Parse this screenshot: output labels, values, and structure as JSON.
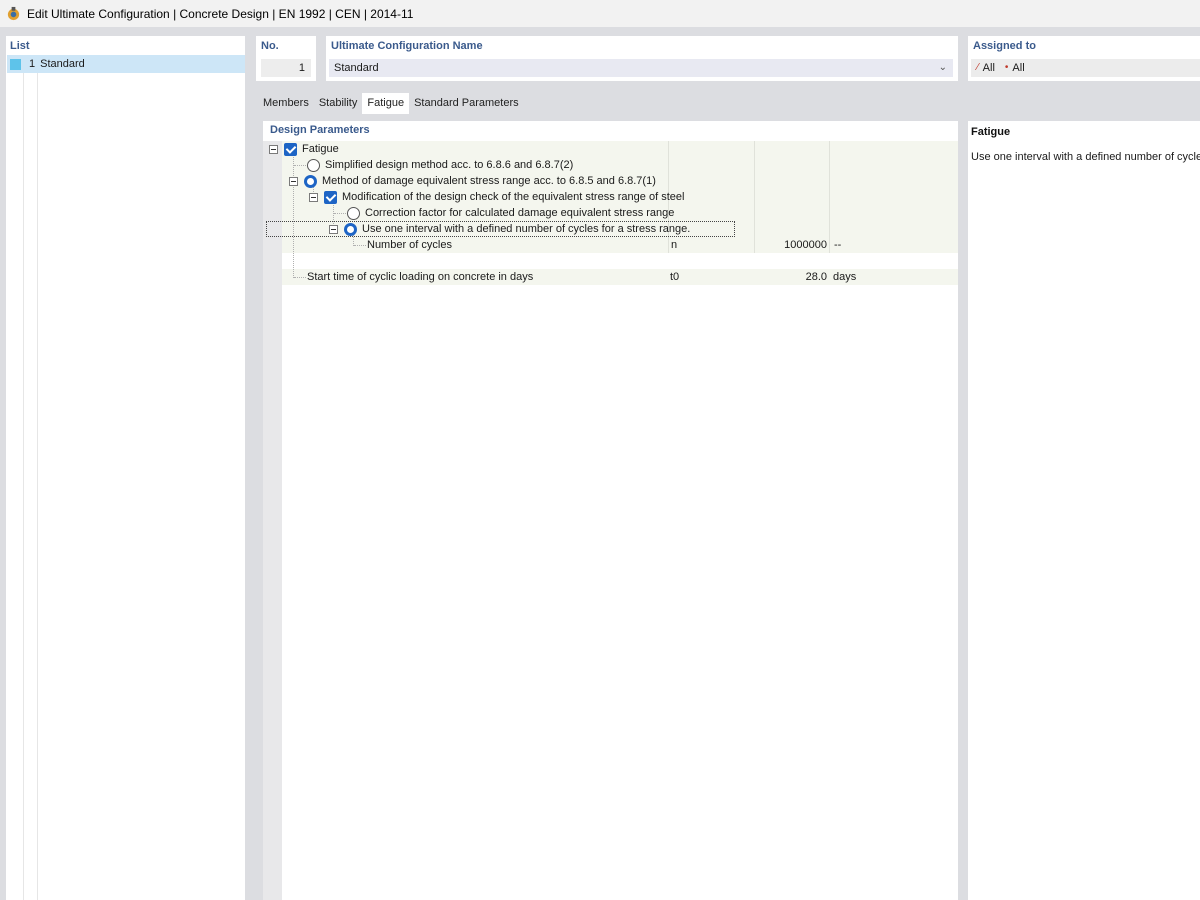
{
  "window": {
    "title": "Edit Ultimate Configuration | Concrete Design | EN 1992 | CEN | 2014-11",
    "icon": "app-logo-icon"
  },
  "list": {
    "header": "List",
    "items": [
      {
        "number": "1",
        "name": "Standard",
        "color": "#5ec3ea"
      }
    ]
  },
  "config": {
    "no_header": "No.",
    "no_value": "1",
    "name_header": "Ultimate Configuration Name",
    "name_value": "Standard",
    "assigned_header": "Assigned to",
    "assigned_members": "All",
    "assigned_nodes": "All"
  },
  "tabs": [
    {
      "label": "Members",
      "active": false
    },
    {
      "label": "Stability",
      "active": false
    },
    {
      "label": "Fatigue",
      "active": true
    },
    {
      "label": "Standard Parameters",
      "active": false
    }
  ],
  "design_parameters": {
    "header": "Design Parameters",
    "tree": {
      "fatigue": "Fatigue",
      "simplified": "Simplified design method acc. to 6.8.6 and 6.8.7(2)",
      "damage_equivalent": "Method of damage equivalent stress range acc. to 6.8.5 and 6.8.7(1)",
      "modification": "Modification of the design check of the equivalent stress range of steel",
      "correction_factor": "Correction factor for calculated damage equivalent stress range",
      "one_interval": "Use one interval with a defined number of cycles for a stress range."
    },
    "rows": {
      "cycles": {
        "label": "Number of cycles",
        "symbol": "n",
        "value": "1000000",
        "unit": "--"
      },
      "start_time": {
        "label": "Start time of cyclic loading on concrete in days",
        "symbol": "t0",
        "value": "28.0",
        "unit": "days"
      }
    }
  },
  "help": {
    "title": "Fatigue",
    "text": "Use one interval with a defined number of cycles"
  },
  "colors": {
    "accent": "#1d64c5",
    "header_text": "#3a5a8c",
    "selection": "#cde6f7"
  }
}
